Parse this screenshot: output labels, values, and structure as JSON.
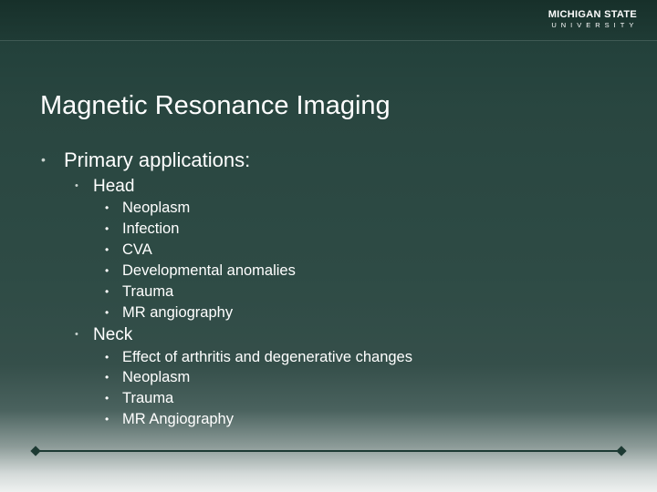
{
  "logo": {
    "line1": "MICHIGAN STATE",
    "line2": "UNIVERSITY"
  },
  "title": "Magnetic Resonance Imaging",
  "bullet_char": "•",
  "content": {
    "heading": "Primary applications:",
    "sections": [
      {
        "label": "Head",
        "items": [
          "Neoplasm",
          "Infection",
          "CVA",
          "Developmental anomalies",
          "Trauma",
          "MR angiography"
        ]
      },
      {
        "label": "Neck",
        "items": [
          "Effect of arthritis and degenerative changes",
          "Neoplasm",
          "Trauma",
          "MR Angiography"
        ]
      }
    ]
  }
}
